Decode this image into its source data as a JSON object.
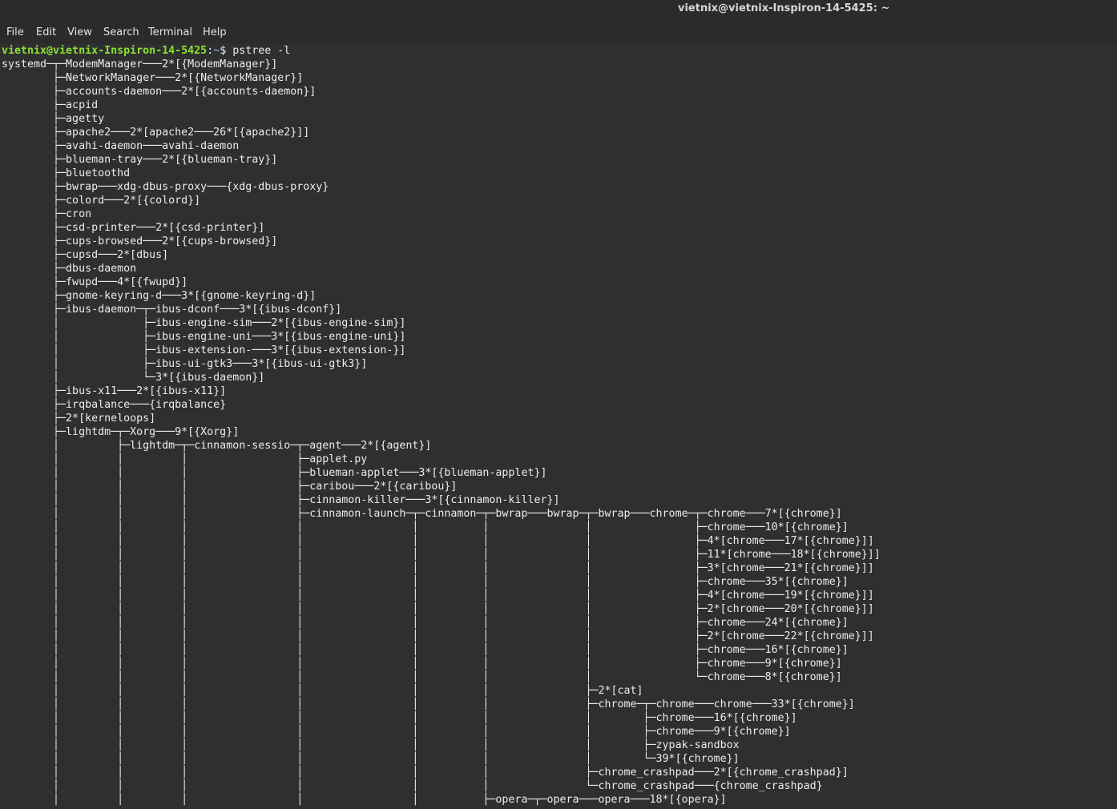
{
  "window": {
    "title": "vietnix@vietnix-Inspiron-14-5425: ~"
  },
  "menubar": {
    "items": [
      {
        "label": "File"
      },
      {
        "label": "Edit"
      },
      {
        "label": "View"
      },
      {
        "label": "Search"
      },
      {
        "label": "Terminal"
      },
      {
        "label": "Help"
      }
    ]
  },
  "colors": {
    "background": "#2f2f2f",
    "text": "#ececec",
    "prompt_user": "#8ae234",
    "prompt_path": "#729fcf"
  },
  "terminal": {
    "prompt_user": "vietnix@vietnix-Inspiron-14-5425",
    "prompt_sep": ":",
    "prompt_path": "~",
    "prompt_symbol": "$",
    "command": "pstree -l",
    "output_lines": [
      "systemd─┬─ModemManager───2*[{ModemManager}]",
      "        ├─NetworkManager───2*[{NetworkManager}]",
      "        ├─accounts-daemon───2*[{accounts-daemon}]",
      "        ├─acpid",
      "        ├─agetty",
      "        ├─apache2───2*[apache2───26*[{apache2}]]",
      "        ├─avahi-daemon───avahi-daemon",
      "        ├─blueman-tray───2*[{blueman-tray}]",
      "        ├─bluetoothd",
      "        ├─bwrap───xdg-dbus-proxy───{xdg-dbus-proxy}",
      "        ├─colord───2*[{colord}]",
      "        ├─cron",
      "        ├─csd-printer───2*[{csd-printer}]",
      "        ├─cups-browsed───2*[{cups-browsed}]",
      "        ├─cupsd───2*[dbus]",
      "        ├─dbus-daemon",
      "        ├─fwupd───4*[{fwupd}]",
      "        ├─gnome-keyring-d───3*[{gnome-keyring-d}]",
      "        ├─ibus-daemon─┬─ibus-dconf───3*[{ibus-dconf}]",
      "        │             ├─ibus-engine-sim───2*[{ibus-engine-sim}]",
      "        │             ├─ibus-engine-uni───3*[{ibus-engine-uni}]",
      "        │             ├─ibus-extension-───3*[{ibus-extension-}]",
      "        │             ├─ibus-ui-gtk3───3*[{ibus-ui-gtk3}]",
      "        │             └─3*[{ibus-daemon}]",
      "        ├─ibus-x11───2*[{ibus-x11}]",
      "        ├─irqbalance───{irqbalance}",
      "        ├─2*[kerneloops]",
      "        ├─lightdm─┬─Xorg───9*[{Xorg}]",
      "        │         ├─lightdm─┬─cinnamon-sessio─┬─agent───2*[{agent}]",
      "        │         │         │                 ├─applet.py",
      "        │         │         │                 ├─blueman-applet───3*[{blueman-applet}]",
      "        │         │         │                 ├─caribou───2*[{caribou}]",
      "        │         │         │                 ├─cinnamon-killer───3*[{cinnamon-killer}]",
      "        │         │         │                 ├─cinnamon-launch─┬─cinnamon─┬─bwrap───bwrap─┬─bwrap───chrome─┬─chrome───7*[{chrome}]",
      "        │         │         │                 │                 │          │               │                ├─chrome───10*[{chrome}]",
      "        │         │         │                 │                 │          │               │                ├─4*[chrome───17*[{chrome}]]",
      "        │         │         │                 │                 │          │               │                ├─11*[chrome───18*[{chrome}]]",
      "        │         │         │                 │                 │          │               │                ├─3*[chrome───21*[{chrome}]]",
      "        │         │         │                 │                 │          │               │                ├─chrome───35*[{chrome}]",
      "        │         │         │                 │                 │          │               │                ├─4*[chrome───19*[{chrome}]]",
      "        │         │         │                 │                 │          │               │                ├─2*[chrome───20*[{chrome}]]",
      "        │         │         │                 │                 │          │               │                ├─chrome───24*[{chrome}]",
      "        │         │         │                 │                 │          │               │                ├─2*[chrome───22*[{chrome}]]",
      "        │         │         │                 │                 │          │               │                ├─chrome───16*[{chrome}]",
      "        │         │         │                 │                 │          │               │                ├─chrome───9*[{chrome}]",
      "        │         │         │                 │                 │          │               │                └─chrome───8*[{chrome}]",
      "        │         │         │                 │                 │          │               ├─2*[cat]",
      "        │         │         │                 │                 │          │               ├─chrome─┬─chrome───chrome───33*[{chrome}]",
      "        │         │         │                 │                 │          │               │        ├─chrome───16*[{chrome}]",
      "        │         │         │                 │                 │          │               │        ├─chrome───9*[{chrome}]",
      "        │         │         │                 │                 │          │               │        ├─zypak-sandbox",
      "        │         │         │                 │                 │          │               │        └─39*[{chrome}]",
      "        │         │         │                 │                 │          │               ├─chrome_crashpad───2*[{chrome_crashpad}]",
      "        │         │         │                 │                 │          │               └─chrome_crashpad───{chrome_crashpad}",
      "        │         │         │                 │                 │          ├─opera─┬─opera───opera───18*[{opera}]"
    ]
  }
}
